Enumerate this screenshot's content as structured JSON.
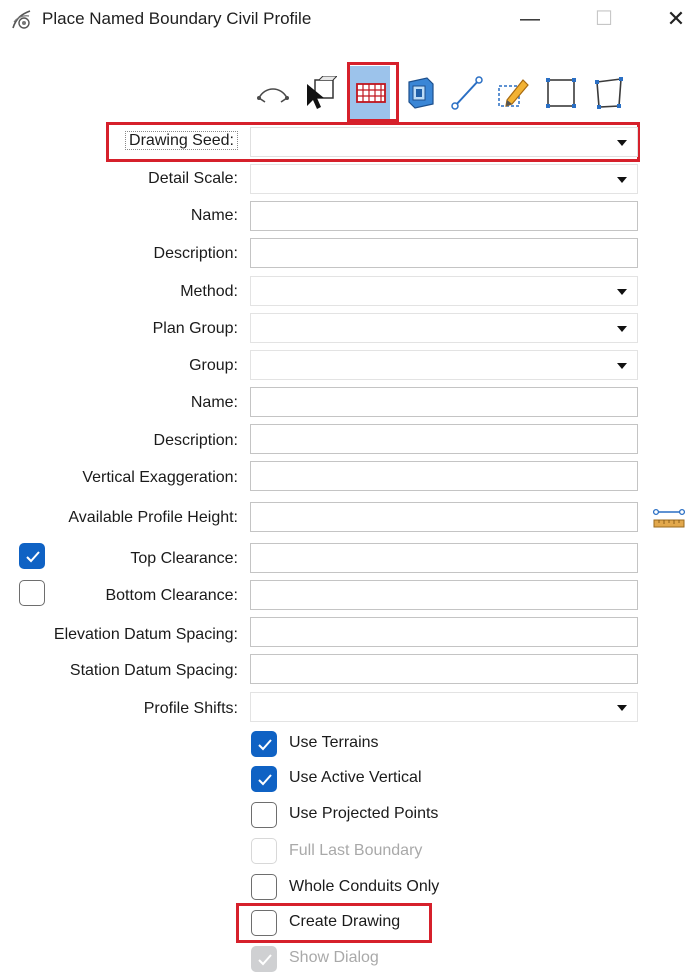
{
  "window": {
    "title": "Place Named Boundary Civil Profile",
    "icon": "place-boundary-app-icon",
    "controls": {
      "minimize": "—",
      "maximize": "☐",
      "close": "✕"
    }
  },
  "toolbar": {
    "tools": [
      {
        "icon": "civil-plan-icon"
      },
      {
        "icon": "select-element-icon"
      },
      {
        "icon": "civil-profile-grid-icon",
        "selected": true
      },
      {
        "icon": "3d-cut-icon"
      },
      {
        "icon": "line-icon"
      },
      {
        "icon": "edit-pencil-icon"
      },
      {
        "icon": "rectangle-icon"
      },
      {
        "icon": "shape-icon"
      }
    ]
  },
  "form": {
    "drawing_seed": {
      "label": "Drawing Seed:",
      "value": ""
    },
    "detail_scale": {
      "label": "Detail Scale:",
      "value": ""
    },
    "name1": {
      "label": "Name:",
      "value": ""
    },
    "description1": {
      "label": "Description:",
      "value": ""
    },
    "method": {
      "label": "Method:",
      "value": ""
    },
    "plan_group": {
      "label": "Plan Group:",
      "value": ""
    },
    "group": {
      "label": "Group:",
      "value": ""
    },
    "name2": {
      "label": "Name:",
      "value": ""
    },
    "description2": {
      "label": "Description:",
      "value": ""
    },
    "vertical_exaggeration": {
      "label": "Vertical Exaggeration:",
      "value": ""
    },
    "available_profile_height": {
      "label": "Available Profile Height:",
      "value": ""
    },
    "top_clearance": {
      "label": "Top Clearance:",
      "value": "",
      "checked": true
    },
    "bottom_clearance": {
      "label": "Bottom Clearance:",
      "value": "",
      "checked": false
    },
    "elevation_datum_spacing": {
      "label": "Elevation Datum Spacing:",
      "value": ""
    },
    "station_datum_spacing": {
      "label": "Station Datum Spacing:",
      "value": ""
    },
    "profile_shifts": {
      "label": "Profile Shifts:",
      "value": ""
    }
  },
  "options": [
    {
      "label": "Use Terrains",
      "checked": true,
      "enabled": true
    },
    {
      "label": "Use Active Vertical",
      "checked": true,
      "enabled": true
    },
    {
      "label": "Use Projected Points",
      "checked": false,
      "enabled": true
    },
    {
      "label": "Full Last Boundary",
      "checked": false,
      "enabled": false
    },
    {
      "label": "Whole Conduits Only",
      "checked": false,
      "enabled": true
    },
    {
      "label": "Create Drawing",
      "checked": false,
      "enabled": true
    },
    {
      "label": "Show Dialog",
      "checked": true,
      "enabled": false
    }
  ],
  "colors": {
    "highlight": "#d6202b",
    "checkbox_on": "#0f62c4",
    "tool_selected": "#9cc3eb"
  }
}
